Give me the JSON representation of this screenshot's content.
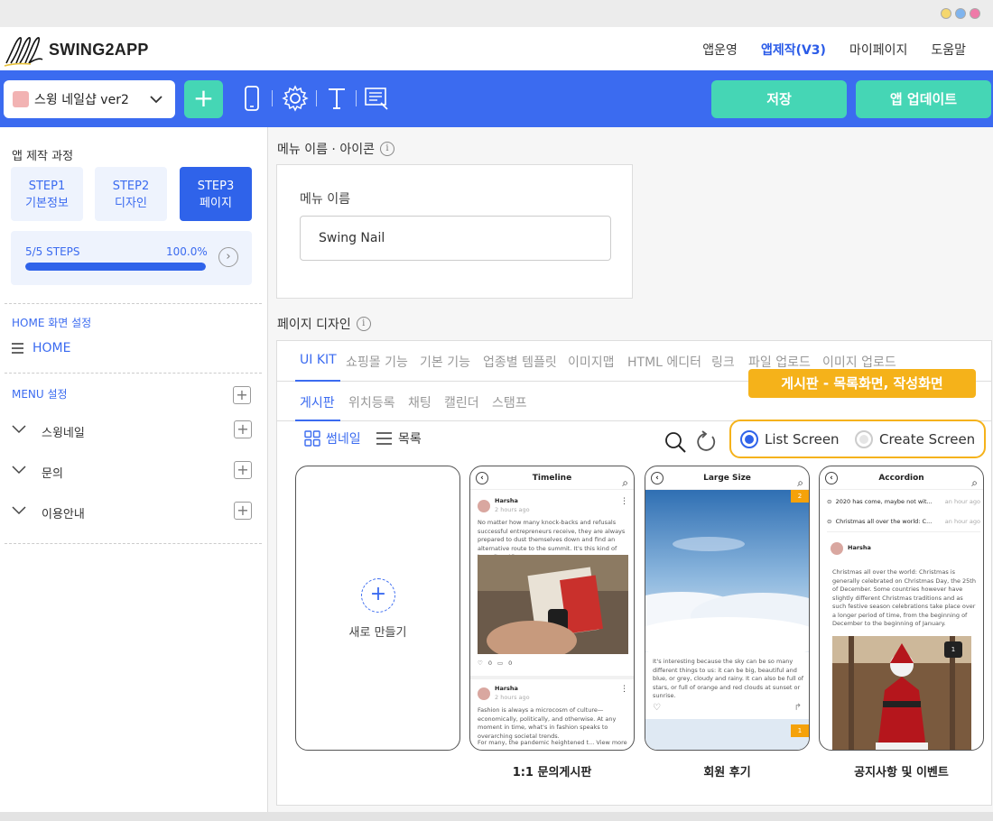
{
  "window": {
    "dot_colors": [
      "#f5d76e",
      "#7fb4ee",
      "#ef7aa8"
    ]
  },
  "brand": {
    "name": "SWING2APP"
  },
  "topmenu": [
    {
      "label": "앱운영",
      "active": false
    },
    {
      "label": "앱제작(V3)",
      "active": true
    },
    {
      "label": "마이페이지",
      "active": false
    },
    {
      "label": "도움말",
      "active": false
    }
  ],
  "toolbar": {
    "app_name": "스윙 네일샵 ver2",
    "add_icon": "plus-icon",
    "tools": [
      "phone-icon",
      "gear-icon",
      "text-icon",
      "page-edit-icon"
    ],
    "save_label": "저장",
    "update_label": "앱 업데이트",
    "accent": "#3b6bf0",
    "button_color": "#45d6b5"
  },
  "sidebar": {
    "process_title": "앱 제작 과정",
    "steps": [
      {
        "line1": "STEP1",
        "line2": "기본정보",
        "active": false
      },
      {
        "line1": "STEP2",
        "line2": "디자인",
        "active": false
      },
      {
        "line1": "STEP3",
        "line2": "페이지",
        "active": true
      }
    ],
    "progress": {
      "label": "5/5 STEPS",
      "percent_text": "100.0%",
      "fraction": 1.0
    },
    "home_section": "HOME 화면 설정",
    "home_item": "HOME",
    "menu_section": "MENU 설정",
    "menu_items": [
      "스윙네일",
      "문의",
      "이용안내"
    ]
  },
  "main": {
    "menu_name_section": "메뉴 이름 · 아이콘",
    "menu_name_label": "메뉴 이름",
    "menu_name_value": "Swing Nail",
    "page_design_section": "페이지 디자인",
    "category_tabs": [
      "UI KIT",
      "쇼핑몰 기능",
      "기본 기능",
      "업종별 템플릿",
      "이미지맵",
      "HTML 에디터",
      "링크",
      "파일 업로드",
      "이미지 업로드"
    ],
    "sub_tabs": [
      "게시판",
      "위치등록",
      "채팅",
      "캘린더",
      "스탬프"
    ],
    "callout": "게시판 - 목록화면, 작성화면",
    "view_thumbnail": "썸네일",
    "view_list": "목록",
    "radio_list": "List Screen",
    "radio_create": "Create Screen",
    "new_card_label": "새로 만들기",
    "templates": [
      {
        "screen_title": "Timeline",
        "caption": "1:1 문의게시판",
        "author": "Harsha",
        "time": "2 hours ago",
        "body": "No matter how many knock-backs and refusals successful entrepreneurs receive, they are always prepared to dust themselves down and find an alternative route to the summit. It's this kind of tenacity ...View more",
        "likes": "0",
        "comments": "0",
        "author2": "Harsha",
        "time2": "2 hours ago",
        "body2": "Fashion is always a microcosm of culture—economically, politically, and otherwise. At any moment in time, what's in fashion speaks to overarching societal trends.",
        "body2_tail": "For many, the pandemic heightened t... View more"
      },
      {
        "screen_title": "Large Size",
        "caption": "회원 후기",
        "badge_top": "2",
        "badge_bottom": "1",
        "body": "It's interesting because the sky can be so many different things to us: it can be big, beautiful and blue, or grey, cloudy and rainy. It can also be full of stars, or full of orange and red clouds at sunset or sunrise."
      },
      {
        "screen_title": "Accordion",
        "caption": "공지사항 및 이벤트",
        "row1": "2020 has come, maybe not wit...",
        "row1_time": "an hour ago",
        "row2": "Christmas all over the world: C...",
        "row2_time": "an hour ago",
        "author": "Harsha",
        "body": "Christmas all over the world: Christmas is generally celebrated on Christmas Day, the 25th of December. Some countries however have slightly different Christmas traditions and as such festive season celebrations take place over a longer period of time, from the beginning of December to the beginning of January.",
        "badge": "1"
      }
    ]
  }
}
